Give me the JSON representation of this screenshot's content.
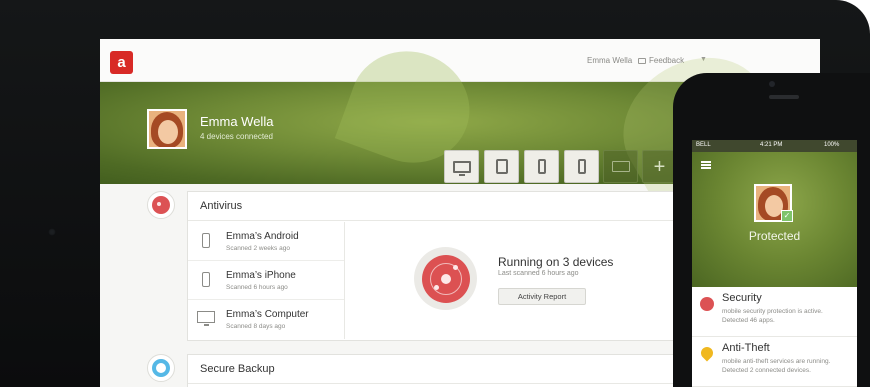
{
  "topbar": {
    "logo_text": "a",
    "user_name": "Emma Wella",
    "feedback_label": "Feedback",
    "menu_caret": "▼"
  },
  "hero": {
    "name": "Emma Wella",
    "subtitle": "4 devices connected",
    "device_buttons": [
      "monitor-icon",
      "tablet-icon",
      "phone-icon",
      "phone-icon",
      "laptop-icon",
      "plus-icon"
    ],
    "add_label": "+"
  },
  "antivirus": {
    "title": "Antivirus",
    "devices": [
      {
        "name": "Emma’s Android",
        "meta": "Scanned 2 weeks ago",
        "icon": "phone-icon"
      },
      {
        "name": "Emma’s iPhone",
        "meta": "Scanned 6 hours ago",
        "icon": "phone-icon"
      },
      {
        "name": "Emma’s Computer",
        "meta": "Scanned 8 days ago",
        "icon": "monitor-icon"
      }
    ],
    "status_title": "Running on 3 devices",
    "status_sub": "Last scanned 6 hours ago",
    "activity_button": "Activity Report"
  },
  "backup": {
    "title": "Secure Backup"
  },
  "phone": {
    "status": {
      "carrier": "BELL",
      "time": "4:21 PM",
      "battery": "100%"
    },
    "protected_label": "Protected",
    "items": [
      {
        "title": "Security",
        "desc": "mobile security protection is active. Detected 46 apps."
      },
      {
        "title": "Anti-Theft",
        "desc": "mobile anti-theft services are running. Detected 2 connected devices."
      }
    ]
  },
  "colors": {
    "brand_red": "#d82a26",
    "hero_green": "#6f8a36",
    "status_red": "#dc5254",
    "backup_blue": "#55b8e6",
    "pin_yellow": "#f0b820"
  }
}
